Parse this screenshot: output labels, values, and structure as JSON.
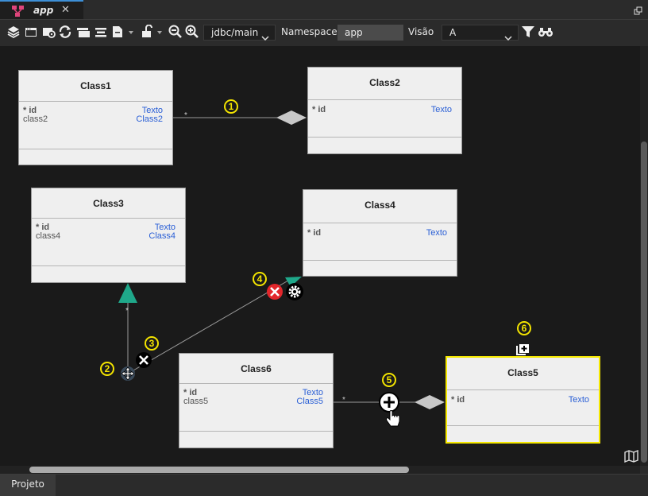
{
  "tab": {
    "label": "app",
    "close": "✕"
  },
  "toolbar": {
    "connection": "jdbc/main",
    "namespace_label": "Namespace",
    "namespace_value": "app",
    "view_label": "Visão",
    "view_value": "A"
  },
  "classes": [
    {
      "name": "Class1",
      "attrs": [
        {
          "name": "* id",
          "type": "Texto"
        },
        {
          "name": "class2",
          "type": "Class2"
        }
      ]
    },
    {
      "name": "Class2",
      "attrs": [
        {
          "name": "* id",
          "type": "Texto"
        }
      ]
    },
    {
      "name": "Class3",
      "attrs": [
        {
          "name": "* id",
          "type": "Texto"
        },
        {
          "name": "class4",
          "type": "Class4"
        }
      ]
    },
    {
      "name": "Class4",
      "attrs": [
        {
          "name": "* id",
          "type": "Texto"
        }
      ]
    },
    {
      "name": "Class6",
      "attrs": [
        {
          "name": "* id",
          "type": "Texto"
        },
        {
          "name": "class5",
          "type": "Class5"
        }
      ]
    },
    {
      "name": "Class5",
      "attrs": [
        {
          "name": "* id",
          "type": "Texto"
        }
      ]
    }
  ],
  "multiplicity": "*",
  "steps": [
    "1",
    "2",
    "3",
    "4",
    "5",
    "6"
  ],
  "bottom": {
    "tab": "Projeto"
  },
  "colors": {
    "accent_tab": "#3d8fd6",
    "selected": "#f5e800",
    "type_text": "#2a5fd6",
    "generalization": "#1fa88a",
    "delete_red": "#e2262b"
  }
}
